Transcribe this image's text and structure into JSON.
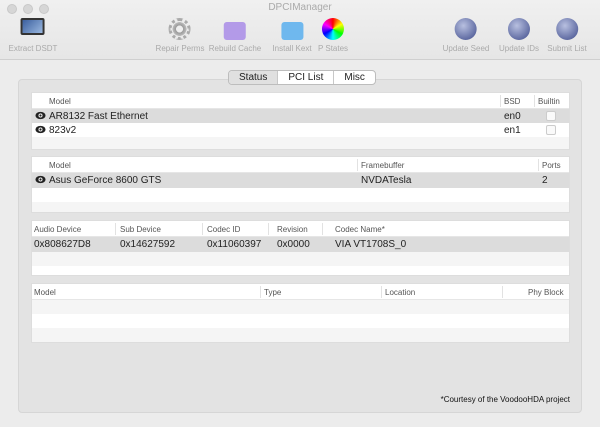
{
  "window": {
    "title": "DPCIManager"
  },
  "toolbar": [
    {
      "label": "Extract DSDT",
      "icon": "imac-icon"
    },
    {
      "label": "Repair Perms",
      "icon": "gear-icon"
    },
    {
      "label": "Rebuild Cache",
      "icon": "purple-folder-icon"
    },
    {
      "label": "Install Kext",
      "icon": "blue-folder-icon"
    },
    {
      "label": "P States",
      "icon": "color-wheel-icon"
    },
    {
      "label": "Update Seed",
      "icon": "globe-icon"
    },
    {
      "label": "Update IDs",
      "icon": "globe-icon"
    },
    {
      "label": "Submit List",
      "icon": "globe-icon"
    }
  ],
  "tabs": [
    {
      "label": "Status",
      "selected": true
    },
    {
      "label": "PCI List"
    },
    {
      "label": "Misc"
    }
  ],
  "network": {
    "headers": [
      "Model",
      "BSD",
      "Builtin"
    ],
    "rows": [
      {
        "model": "AR8132 Fast Ethernet",
        "bsd": "en0",
        "builtin": false
      },
      {
        "model": "823v2",
        "bsd": "en1",
        "builtin": false
      }
    ]
  },
  "graphics": {
    "headers": [
      "Model",
      "Framebuffer",
      "Ports"
    ],
    "rows": [
      {
        "model": "Asus GeForce 8600 GTS",
        "framebuffer": "NVDATesla",
        "ports": "2"
      }
    ]
  },
  "audio": {
    "headers": [
      "Audio Device",
      "Sub Device",
      "Codec ID",
      "Revision",
      "Codec Name*"
    ],
    "rows": [
      {
        "audio": "0x808627D8",
        "sub": "0x14627592",
        "codec": "0x11060397",
        "rev": "0x0000",
        "name": "VIA VT1708S_0"
      }
    ]
  },
  "storage": {
    "headers": [
      "Model",
      "Type",
      "Location",
      "Phy Block"
    ]
  },
  "footer": "*Courtesy of the VoodooHDA project"
}
